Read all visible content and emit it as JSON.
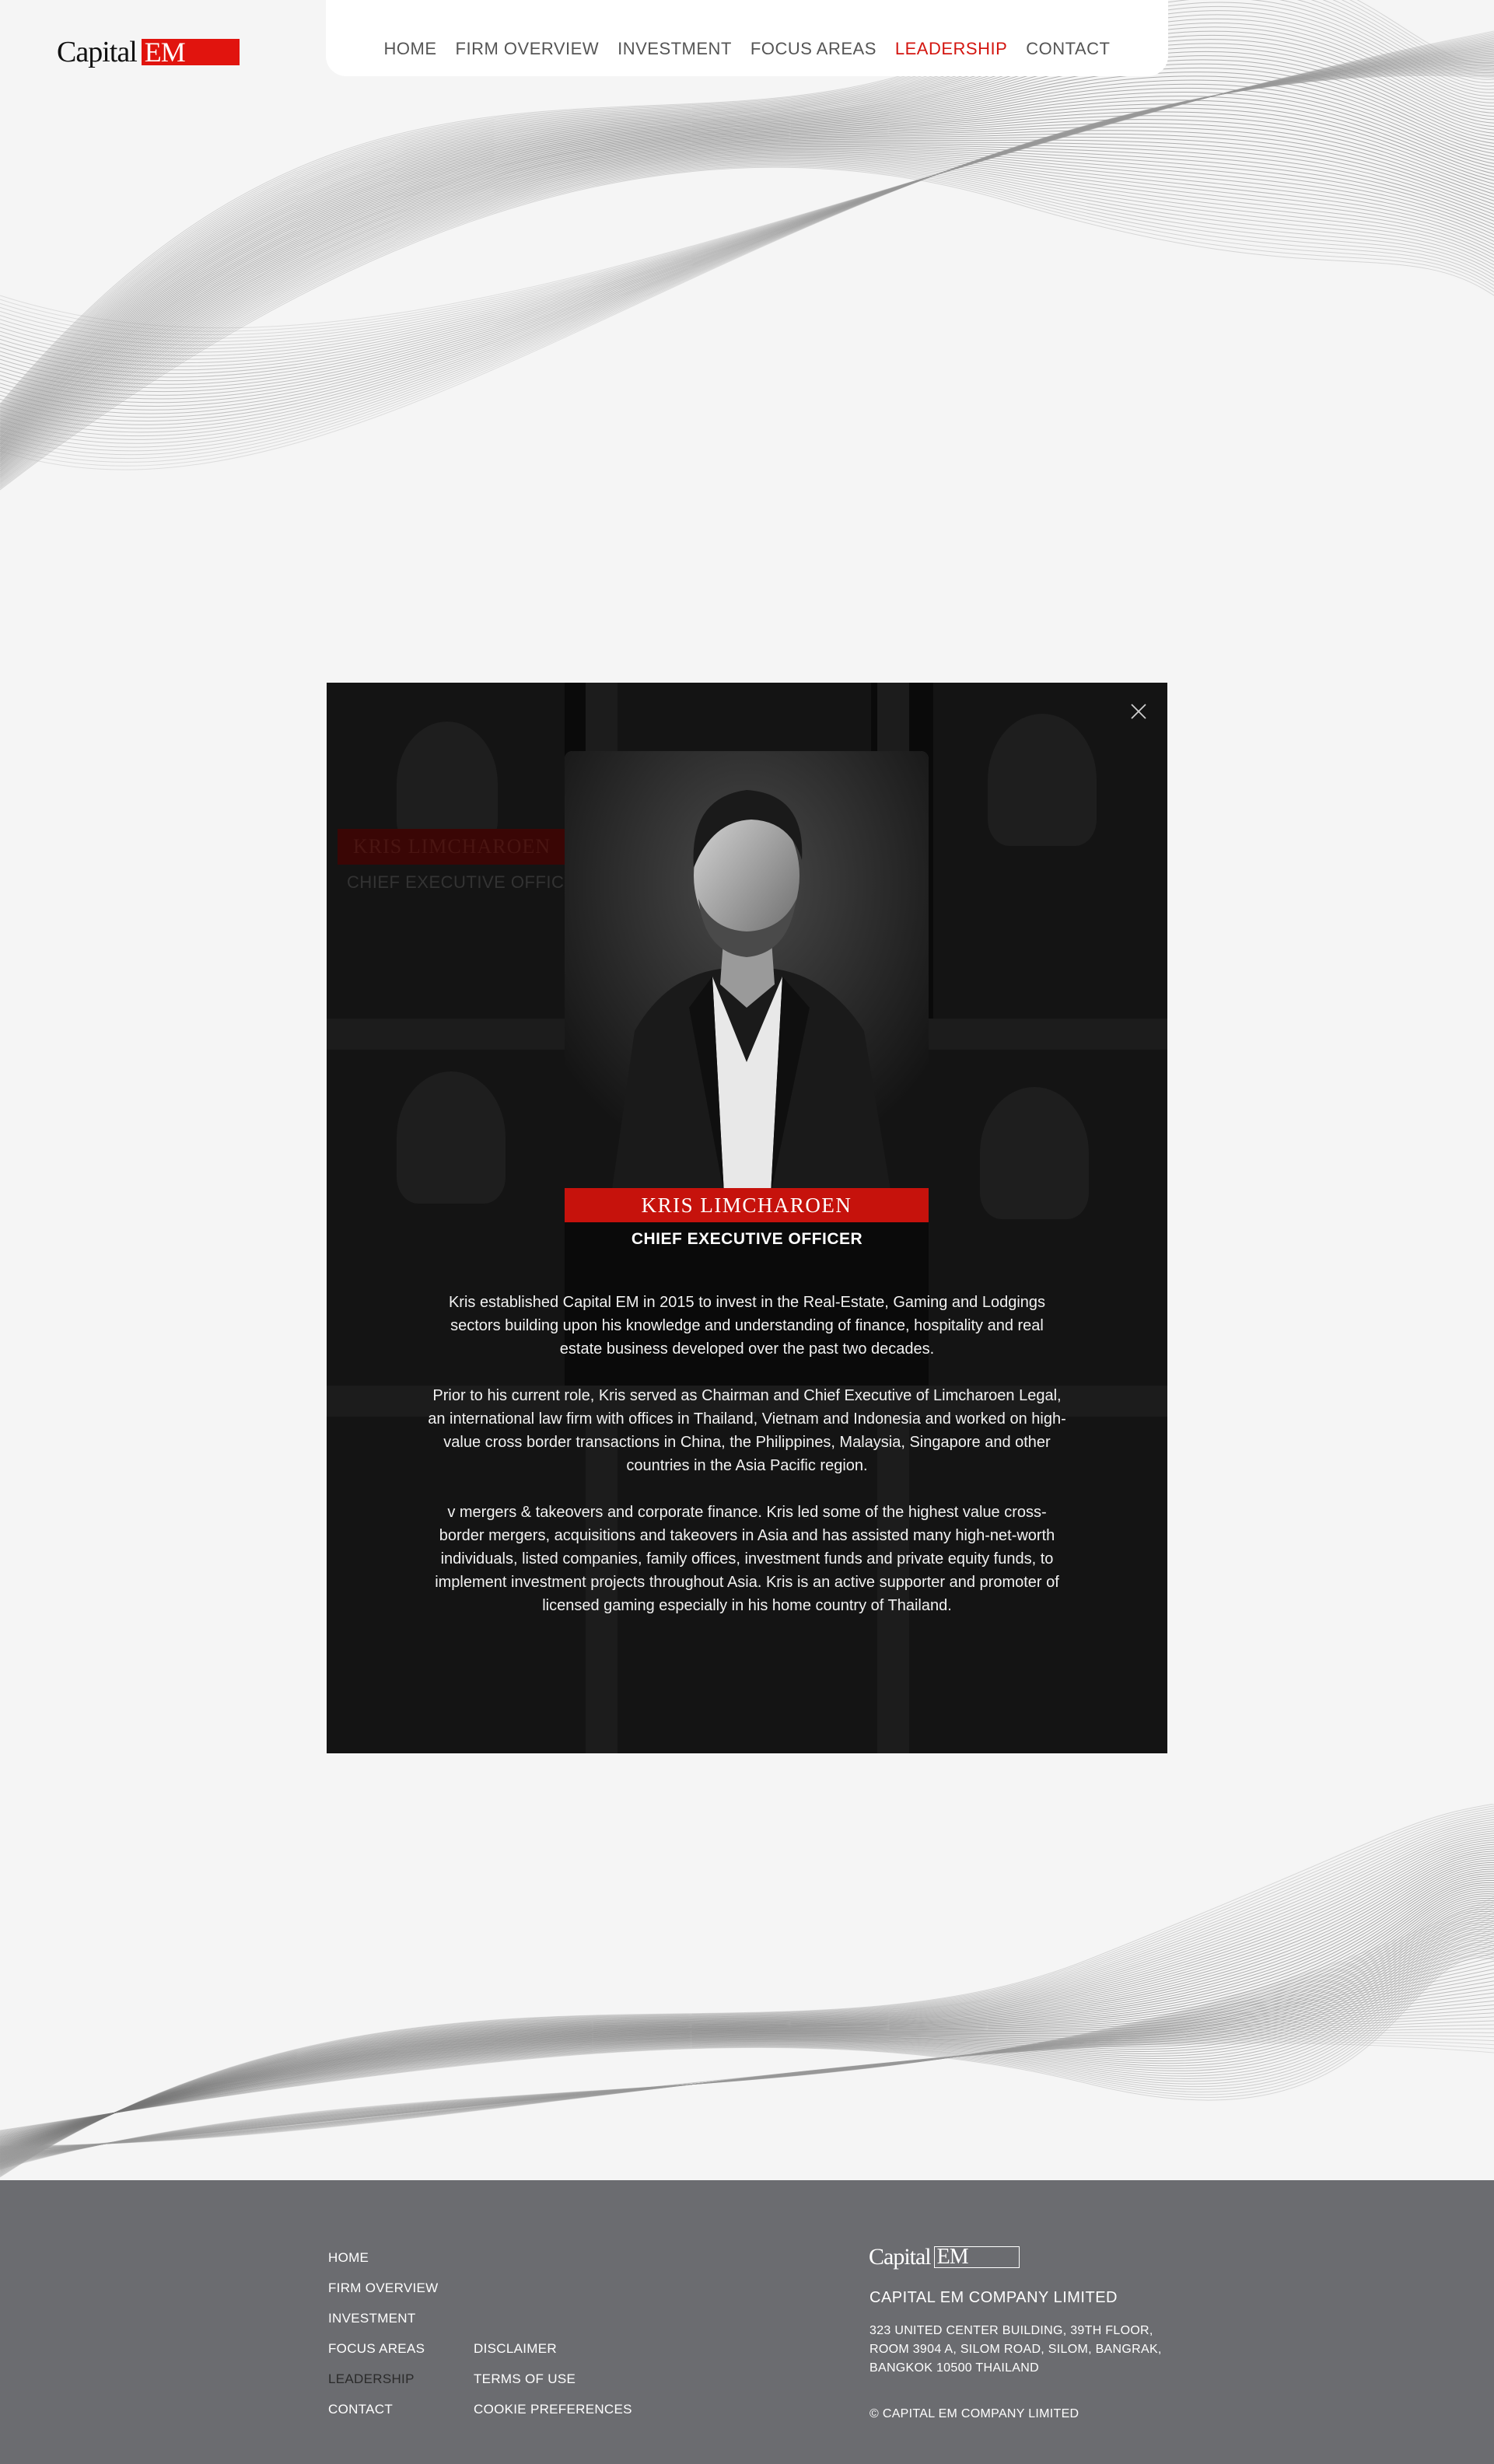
{
  "brand": {
    "word": "Capital",
    "mark": "EM",
    "accent_color": "#e1140e"
  },
  "nav": {
    "items": [
      {
        "label": "HOME",
        "active": false
      },
      {
        "label": "FIRM OVERVIEW",
        "active": false
      },
      {
        "label": "INVESTMENT",
        "active": false
      },
      {
        "label": "FOCUS AREAS",
        "active": false
      },
      {
        "label": "LEADERSHIP",
        "active": true
      },
      {
        "label": "CONTACT",
        "active": false
      }
    ]
  },
  "modal": {
    "close_icon": "close-icon",
    "background_name": "KRIS LIMCHAROEN",
    "background_title": "CHIEF EXECUTIVE OFFICER",
    "name": "KRIS LIMCHAROEN",
    "role": "CHIEF EXECUTIVE OFFICER",
    "bio": [
      "Kris established Capital EM in 2015 to invest in the Real-Estate, Gaming and Lodgings sectors building upon his knowledge and understanding of finance, hospitality and real estate business developed over the past two decades.",
      "Prior to his current role, Kris served as Chairman and Chief Executive of Limcharoen Legal, an international law firm with offices in Thailand, Vietnam and Indonesia and worked on high-value cross border transactions in China, the Philippines, Malaysia, Singapore and other countries in the Asia Pacific region.",
      "v mergers & takeovers and corporate finance. Kris led some of the highest value cross-border mergers, acquisitions and takeovers in Asia and has assisted many high-net-worth individuals, listed companies, family offices, investment funds and private equity funds, to implement investment projects throughout Asia. Kris is an active supporter and promoter of licensed gaming especially in his home country of Thailand."
    ]
  },
  "footer": {
    "links_col1": [
      "HOME",
      "FIRM OVERVIEW",
      "INVESTMENT",
      "FOCUS AREAS",
      "LEADERSHIP",
      "CONTACT"
    ],
    "links_col2": [
      "DISCLAIMER",
      "TERMS OF USE",
      "COOKIE PREFERENCES"
    ],
    "company": "CAPITAL EM COMPANY LIMITED",
    "address_lines": [
      "323 UNITED CENTER BUILDING, 39TH FLOOR,",
      "ROOM 3904 A, SILOM ROAD, SILOM, BANGRAK,",
      "BANGKOK 10500 THAILAND"
    ],
    "copyright": "© CAPITAL EM COMPANY LIMITED",
    "background_color": "#6b6c70"
  }
}
